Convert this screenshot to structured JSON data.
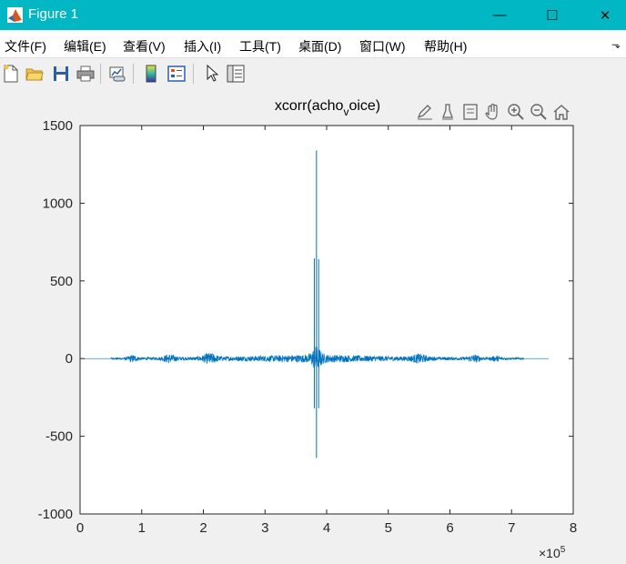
{
  "window": {
    "title": "Figure 1",
    "minimize_glyph": "—",
    "maximize_glyph": "☐",
    "close_glyph": "✕"
  },
  "menu": [
    {
      "label": "文件(F)"
    },
    {
      "label": "编辑(E)"
    },
    {
      "label": "查看(V)"
    },
    {
      "label": "插入(I)"
    },
    {
      "label": "工具(T)"
    },
    {
      "label": "桌面(D)"
    },
    {
      "label": "窗口(W)"
    },
    {
      "label": "帮助(H)"
    }
  ],
  "menu_pin_glyph": "⬎",
  "toolbar": [
    {
      "icon": "new-figure-icon"
    },
    {
      "icon": "open-file-icon"
    },
    {
      "icon": "save-icon"
    },
    {
      "icon": "print-icon"
    },
    {
      "icon": "link-plot-icon"
    },
    {
      "icon": "insert-colorbar-icon"
    },
    {
      "icon": "insert-legend-icon"
    },
    {
      "icon": "edit-plot-icon"
    },
    {
      "icon": "property-inspector-icon"
    }
  ],
  "axes_toolbar": [
    {
      "icon": "brush-edit-icon"
    },
    {
      "icon": "data-cursor-icon"
    },
    {
      "icon": "pan-icon"
    },
    {
      "icon": "rotate-icon"
    },
    {
      "icon": "zoom-in-icon"
    },
    {
      "icon": "zoom-out-icon"
    },
    {
      "icon": "home-icon"
    }
  ],
  "colors": {
    "titlebar": "#00b7c3",
    "series": "#0072bd",
    "axes": "#262626"
  },
  "chart_data": {
    "type": "line",
    "title_main": "xcorr(acho",
    "title_sub": "v",
    "title_end": "oice)",
    "xlabel": "",
    "ylabel": "",
    "xlim": [
      0,
      8
    ],
    "ylim": [
      -1000,
      1500
    ],
    "x_exponent_label": "×10",
    "x_exponent_power": "5",
    "x_ticks": [
      "0",
      "1",
      "2",
      "3",
      "4",
      "5",
      "6",
      "7",
      "8"
    ],
    "y_ticks": [
      "1500",
      "1000",
      "500",
      "0",
      "-500",
      "-1000"
    ],
    "x_tick_values": [
      0,
      1,
      2,
      3,
      4,
      5,
      6,
      7,
      8
    ],
    "y_tick_values": [
      1500,
      1000,
      500,
      0,
      -500,
      -1000
    ],
    "grid": false,
    "series_extent_x": [
      0,
      7.6
    ],
    "peaks": [
      {
        "x": 3.8,
        "y": 645
      },
      {
        "x": 3.8,
        "y": -320
      },
      {
        "x": 3.835,
        "y": 1340
      },
      {
        "x": 3.835,
        "y": -640
      },
      {
        "x": 3.87,
        "y": 640
      },
      {
        "x": 3.87,
        "y": -320
      }
    ]
  }
}
